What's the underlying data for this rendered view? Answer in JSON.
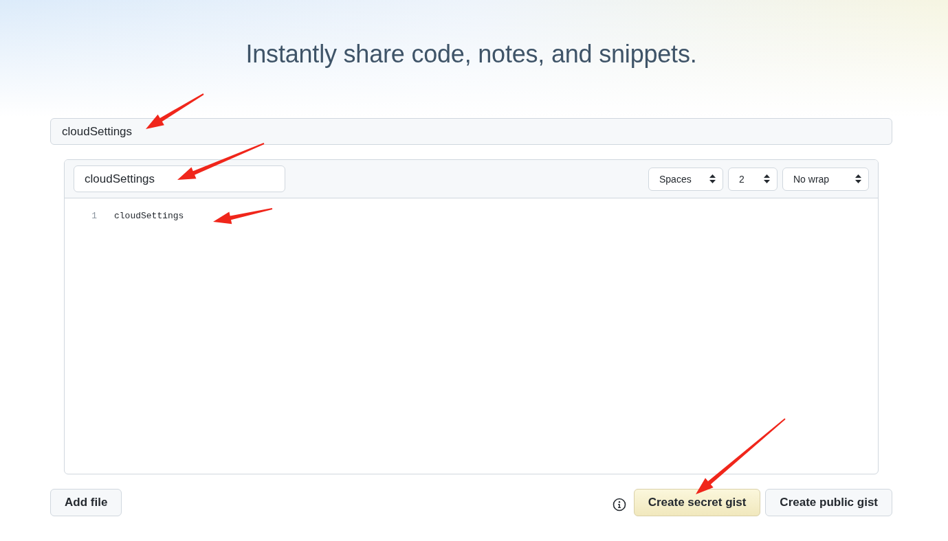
{
  "title": "Instantly share code, notes, and snippets.",
  "description": {
    "value": "cloudSettings"
  },
  "file": {
    "filename": "cloudSettings",
    "indent_mode": "Spaces",
    "indent_size": "2",
    "wrap_mode": "No wrap",
    "lines": [
      {
        "number": "1",
        "text": "cloudSettings"
      }
    ]
  },
  "add_file_button": "Add file",
  "buttons": [
    {
      "label": "Create secret gist",
      "kind": "primary"
    },
    {
      "label": "Create public gist",
      "kind": "default"
    }
  ]
}
